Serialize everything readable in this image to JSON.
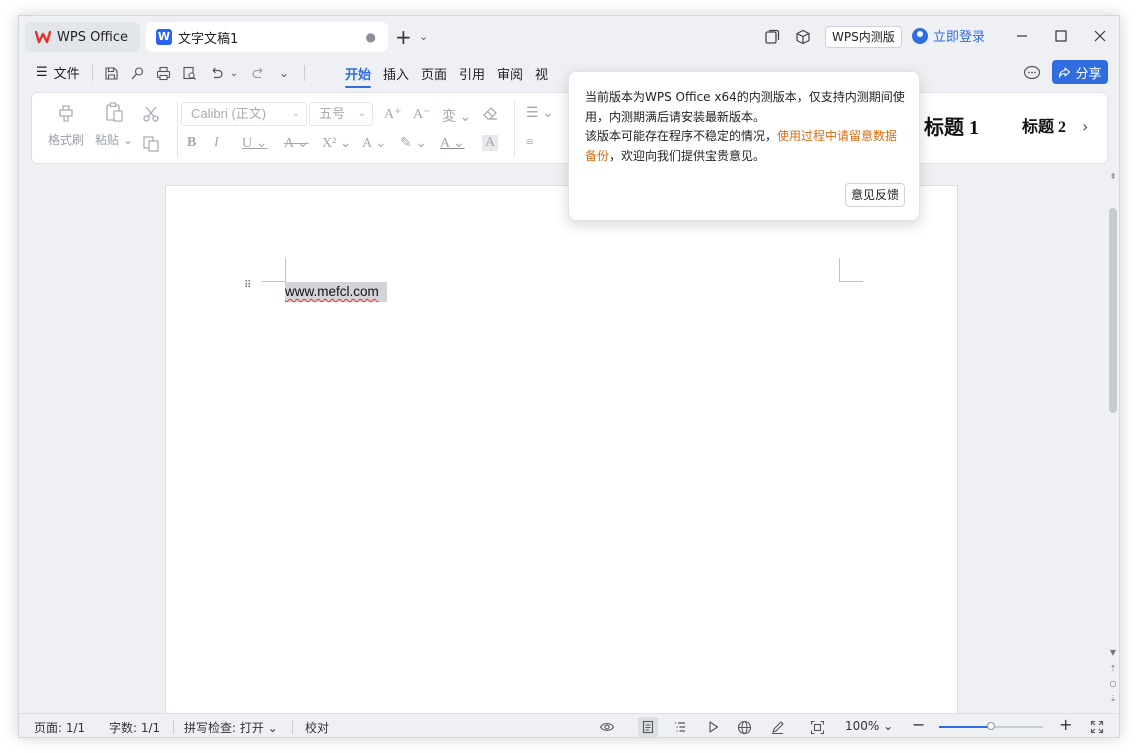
{
  "titlebar": {
    "home_tab": "WPS Office",
    "doc_tab": "文字文稿1",
    "doc_tab_dot": "●",
    "new_tab_symbol": "+",
    "beta_label": "WPS内测版",
    "login_label": "立即登录"
  },
  "menu": {
    "file_label": "文件",
    "tabs": [
      "开始",
      "插入",
      "页面",
      "引用",
      "审阅",
      "视"
    ],
    "active_tab": "开始",
    "share_label": "分享"
  },
  "ribbon": {
    "format_painter": "格式刷",
    "paste": "粘贴",
    "font_name": "Calibri (正文)",
    "font_size": "五号",
    "style_heading1": "标题 1",
    "style_heading2": "标题 2"
  },
  "document": {
    "text": "www.mefcl.com"
  },
  "popup": {
    "line1": "当前版本为WPS Office x64的内测版本，仅支持内测期间使",
    "line2": "用，内测期满后请安装最新版本。",
    "line3_prefix": "该版本可能存在程序不稳定的情况，",
    "line3_warn": "使用过程中请留意数据",
    "line4_warn": "备份",
    "line4_suffix": "，欢迎向我们提供宝贵意见。",
    "feedback_button": "意见反馈",
    "warn_color": "#d96a12"
  },
  "statusbar": {
    "page": "页面: 1/1",
    "word_count": "字数: 1/1",
    "spell_check": "拼写检查: 打开",
    "proofread": "校对",
    "zoom": "100%",
    "zoom_fraction": 0.5
  },
  "colors": {
    "accent": "#2f6de1",
    "wps_red": "#e0322b"
  }
}
